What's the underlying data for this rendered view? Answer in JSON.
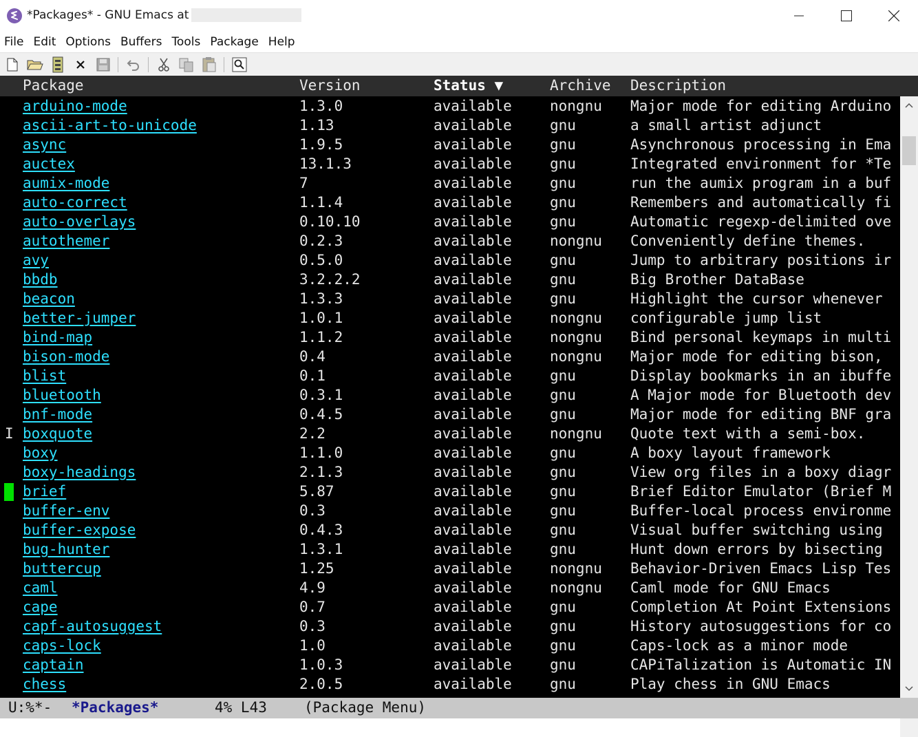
{
  "window": {
    "title": "*Packages* - GNU Emacs at",
    "minimize_icon": "minimize-icon",
    "maximize_icon": "maximize-icon",
    "close_icon": "close-icon"
  },
  "menubar": {
    "items": [
      "File",
      "Edit",
      "Options",
      "Buffers",
      "Tools",
      "Package",
      "Help"
    ]
  },
  "toolbar": {
    "buttons": [
      "new-file-icon",
      "open-folder-icon",
      "open-directory-icon",
      "close-icon",
      "save-icon",
      "undo-icon",
      "cut-icon",
      "copy-icon",
      "paste-icon",
      "search-icon"
    ]
  },
  "header": {
    "package": "Package",
    "version": "Version",
    "status": "Status ▼",
    "archive": "Archive",
    "description": "Description"
  },
  "packages": [
    {
      "mark": "",
      "name": "arduino-mode",
      "version": "1.3.0",
      "status": "available",
      "archive": "nongnu",
      "description": "Major mode for editing Arduino"
    },
    {
      "mark": "",
      "name": "ascii-art-to-unicode",
      "version": "1.13",
      "status": "available",
      "archive": "gnu",
      "description": "a small artist adjunct"
    },
    {
      "mark": "",
      "name": "async",
      "version": "1.9.5",
      "status": "available",
      "archive": "gnu",
      "description": "Asynchronous processing in Ema"
    },
    {
      "mark": "",
      "name": "auctex",
      "version": "13.1.3",
      "status": "available",
      "archive": "gnu",
      "description": "Integrated environment for *Te"
    },
    {
      "mark": "",
      "name": "aumix-mode",
      "version": "7",
      "status": "available",
      "archive": "gnu",
      "description": "run the aumix program in a buf"
    },
    {
      "mark": "",
      "name": "auto-correct",
      "version": "1.1.4",
      "status": "available",
      "archive": "gnu",
      "description": "Remembers and automatically fi"
    },
    {
      "mark": "",
      "name": "auto-overlays",
      "version": "0.10.10",
      "status": "available",
      "archive": "gnu",
      "description": "Automatic regexp-delimited ove"
    },
    {
      "mark": "",
      "name": "autothemer",
      "version": "0.2.3",
      "status": "available",
      "archive": "nongnu",
      "description": "Conveniently define themes."
    },
    {
      "mark": "",
      "name": "avy",
      "version": "0.5.0",
      "status": "available",
      "archive": "gnu",
      "description": "Jump to arbitrary positions ir"
    },
    {
      "mark": "",
      "name": "bbdb",
      "version": "3.2.2.2",
      "status": "available",
      "archive": "gnu",
      "description": "Big Brother DataBase"
    },
    {
      "mark": "",
      "name": "beacon",
      "version": "1.3.3",
      "status": "available",
      "archive": "gnu",
      "description": "Highlight the cursor whenever"
    },
    {
      "mark": "",
      "name": "better-jumper",
      "version": "1.0.1",
      "status": "available",
      "archive": "nongnu",
      "description": "configurable jump list"
    },
    {
      "mark": "",
      "name": "bind-map",
      "version": "1.1.2",
      "status": "available",
      "archive": "nongnu",
      "description": "Bind personal keymaps in multi"
    },
    {
      "mark": "",
      "name": "bison-mode",
      "version": "0.4",
      "status": "available",
      "archive": "nongnu",
      "description": "Major mode for editing bison,"
    },
    {
      "mark": "",
      "name": "blist",
      "version": "0.1",
      "status": "available",
      "archive": "gnu",
      "description": "Display bookmarks in an ibuffe"
    },
    {
      "mark": "",
      "name": "bluetooth",
      "version": "0.3.1",
      "status": "available",
      "archive": "gnu",
      "description": "A Major mode for Bluetooth dev"
    },
    {
      "mark": "",
      "name": "bnf-mode",
      "version": "0.4.5",
      "status": "available",
      "archive": "gnu",
      "description": "Major mode for editing BNF gra"
    },
    {
      "mark": "I",
      "name": "boxquote",
      "version": "2.2",
      "status": "available",
      "archive": "nongnu",
      "description": "Quote text with a semi-box."
    },
    {
      "mark": "",
      "name": "boxy",
      "version": "1.1.0",
      "status": "available",
      "archive": "gnu",
      "description": "A boxy layout framework"
    },
    {
      "mark": "",
      "name": "boxy-headings",
      "version": "2.1.3",
      "status": "available",
      "archive": "gnu",
      "description": "View org files in a boxy diagr"
    },
    {
      "mark": "",
      "name": "brief",
      "version": "5.87",
      "status": "available",
      "archive": "gnu",
      "description": "Brief Editor Emulator (Brief M"
    },
    {
      "mark": "",
      "name": "buffer-env",
      "version": "0.3",
      "status": "available",
      "archive": "gnu",
      "description": "Buffer-local process environme"
    },
    {
      "mark": "",
      "name": "buffer-expose",
      "version": "0.4.3",
      "status": "available",
      "archive": "gnu",
      "description": "Visual buffer switching using"
    },
    {
      "mark": "",
      "name": "bug-hunter",
      "version": "1.3.1",
      "status": "available",
      "archive": "gnu",
      "description": "Hunt down errors by bisecting"
    },
    {
      "mark": "",
      "name": "buttercup",
      "version": "1.25",
      "status": "available",
      "archive": "nongnu",
      "description": "Behavior-Driven Emacs Lisp Tes"
    },
    {
      "mark": "",
      "name": "caml",
      "version": "4.9",
      "status": "available",
      "archive": "nongnu",
      "description": "Caml mode for GNU Emacs"
    },
    {
      "mark": "",
      "name": "cape",
      "version": "0.7",
      "status": "available",
      "archive": "gnu",
      "description": "Completion At Point Extensions"
    },
    {
      "mark": "",
      "name": "capf-autosuggest",
      "version": "0.3",
      "status": "available",
      "archive": "gnu",
      "description": "History autosuggestions for co"
    },
    {
      "mark": "",
      "name": "caps-lock",
      "version": "1.0",
      "status": "available",
      "archive": "gnu",
      "description": "Caps-lock as a minor mode"
    },
    {
      "mark": "",
      "name": "captain",
      "version": "1.0.3",
      "status": "available",
      "archive": "gnu",
      "description": "CAPiTalization is Automatic IN"
    },
    {
      "mark": "",
      "name": "chess",
      "version": "2.0.5",
      "status": "available",
      "archive": "gnu",
      "description": "Play chess in GNU Emacs"
    }
  ],
  "cursor_row": 20,
  "modeline": {
    "state": "U:%*-",
    "buffer": "*Packages*",
    "position": "4% L43",
    "mode": "(Package Menu)"
  },
  "colors": {
    "background": "#000000",
    "link": "#2ee0ff",
    "cursor": "#00e000",
    "modeline": "#c8c8c8"
  }
}
